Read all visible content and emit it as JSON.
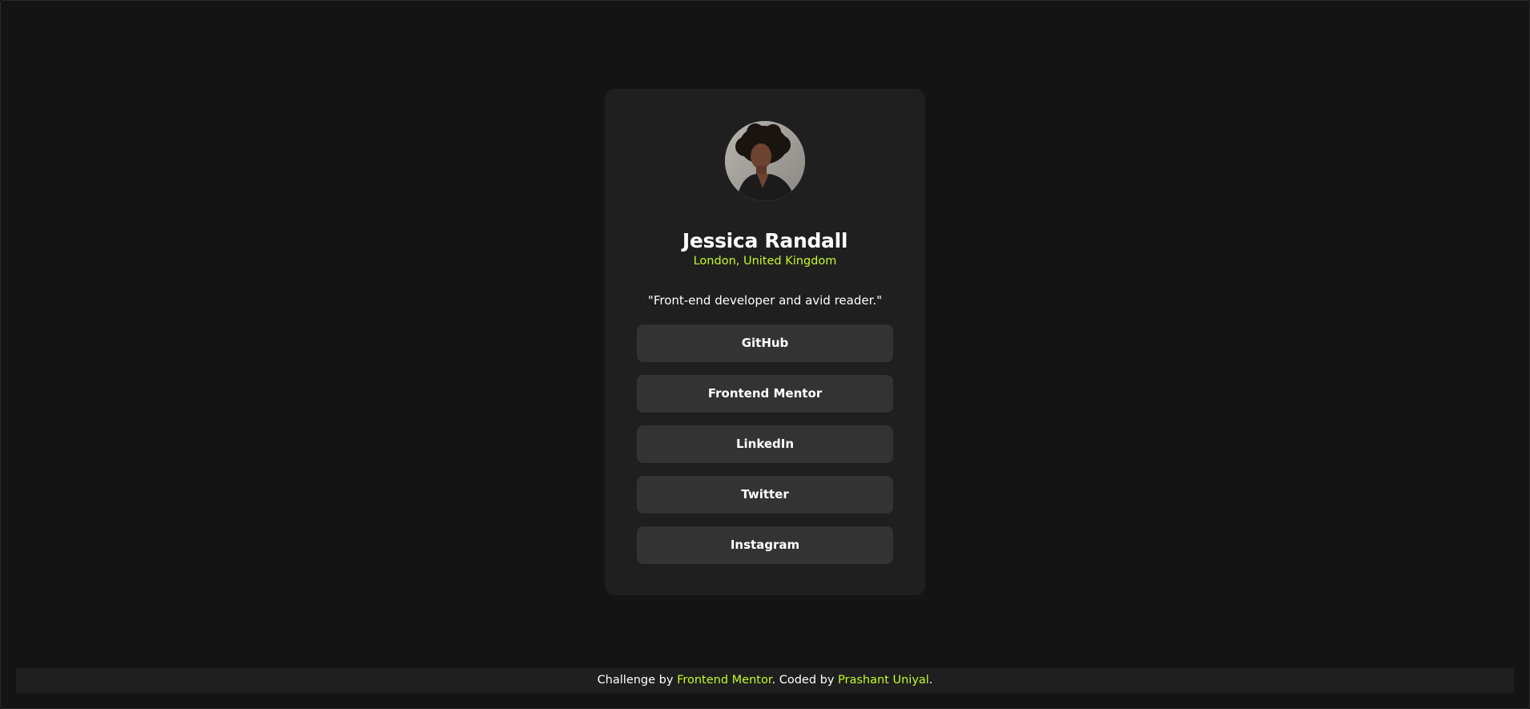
{
  "profile": {
    "name": "Jessica Randall",
    "location": "London, United Kingdom",
    "bio": "\"Front-end developer and avid reader.\"",
    "avatar_icon": "avatar-photo"
  },
  "links": [
    {
      "label": "GitHub"
    },
    {
      "label": "Frontend Mentor"
    },
    {
      "label": "LinkedIn"
    },
    {
      "label": "Twitter"
    },
    {
      "label": "Instagram"
    }
  ],
  "footer": {
    "prefix": "Challenge by ",
    "challenge_link": "Frontend Mentor",
    "middle": ". Coded by ",
    "author_link": "Prashant Uniyal",
    "suffix": "."
  },
  "colors": {
    "background": "#141414",
    "card": "#1f1f1f",
    "button": "#333333",
    "accent": "#c4f82a",
    "text": "#ffffff"
  }
}
